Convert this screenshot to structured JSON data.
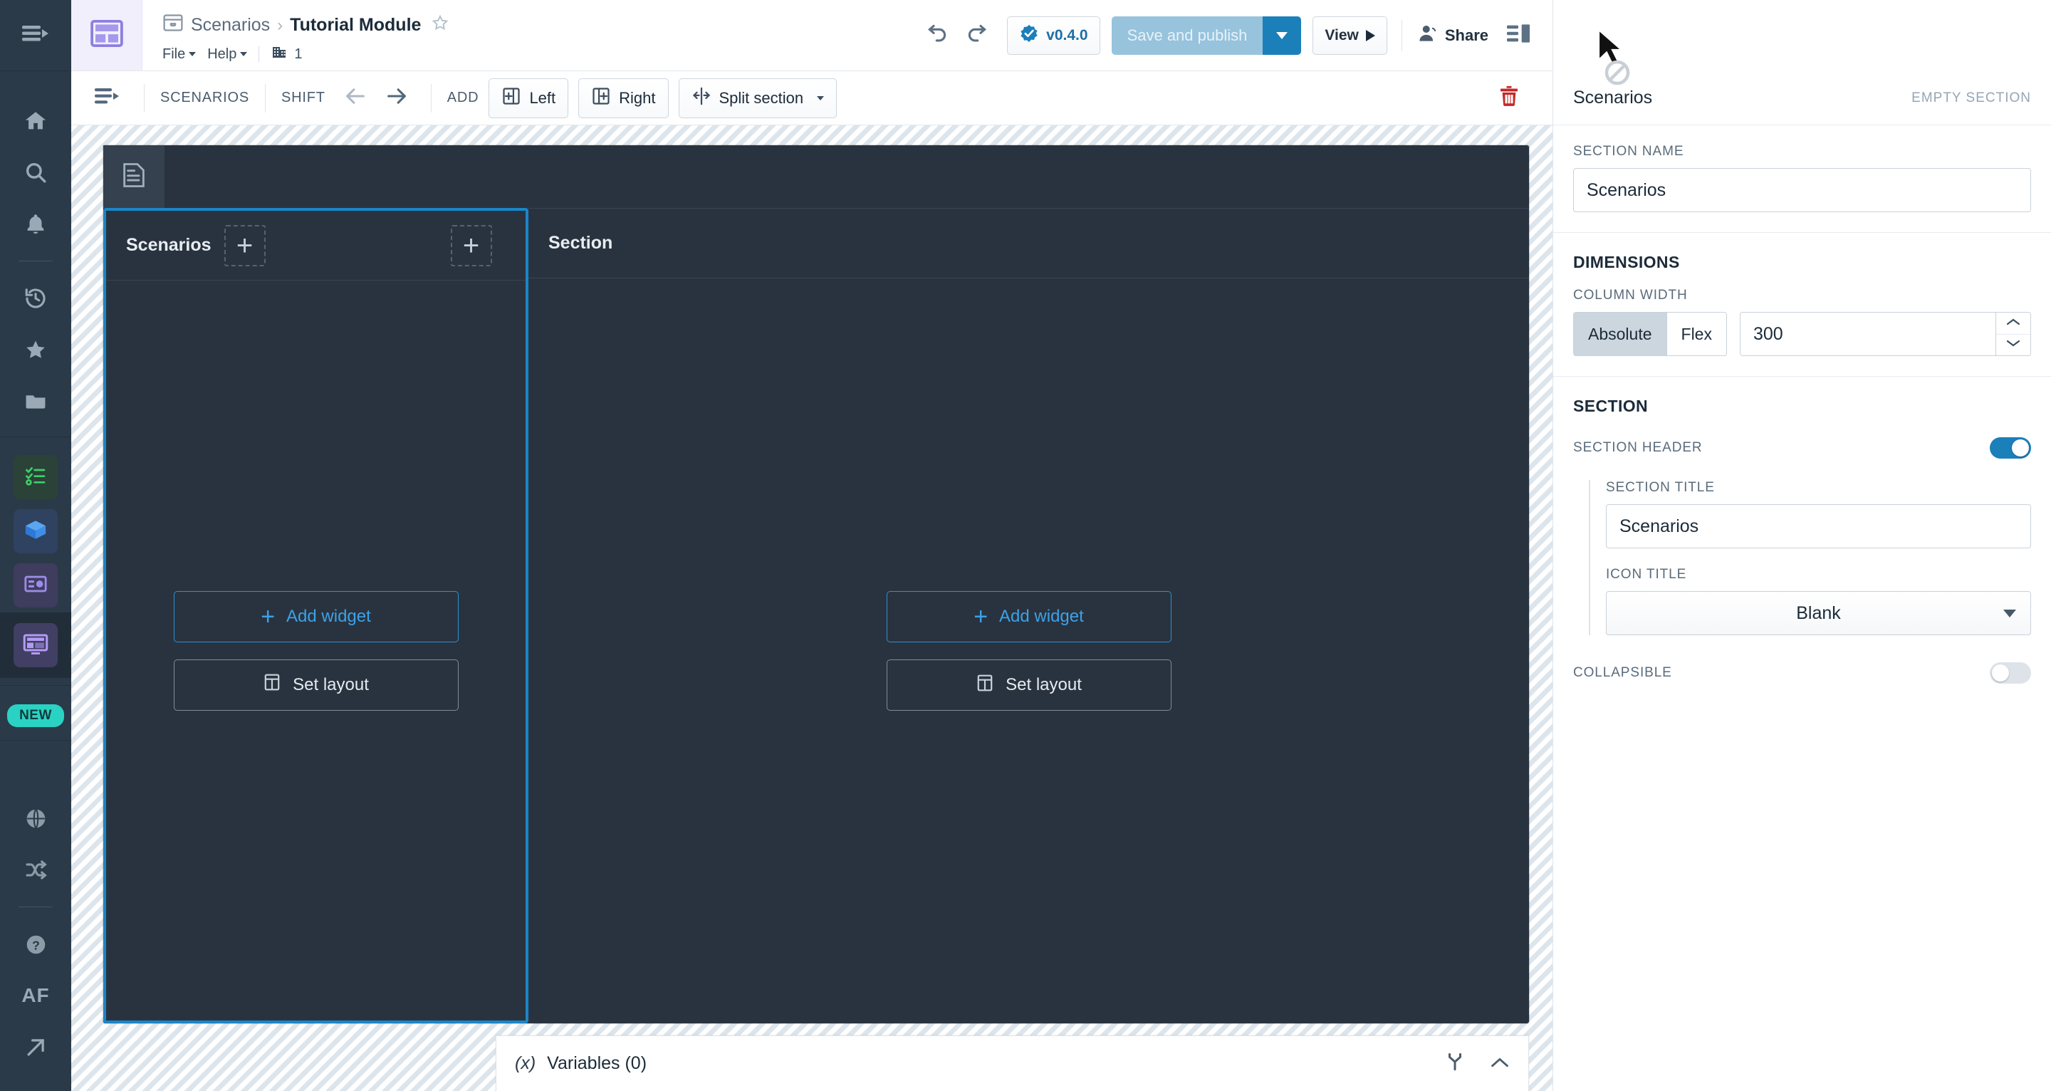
{
  "app": {
    "rail": {
      "toggle_icon": "sidebar-expand-icon",
      "items": [
        {
          "name": "home",
          "icon": "home-icon"
        },
        {
          "name": "search",
          "icon": "search-icon"
        },
        {
          "name": "notifications",
          "icon": "bell-icon"
        },
        {
          "name": "recent",
          "icon": "history-clock-icon"
        },
        {
          "name": "favorites",
          "icon": "star-icon"
        },
        {
          "name": "projects",
          "icon": "folder-icon"
        }
      ],
      "apps": [
        {
          "name": "checklist-app",
          "icon": "checklist-icon",
          "color": "#3ecf6a"
        },
        {
          "name": "object-explorer-app",
          "icon": "cube-icon",
          "color": "#3f8ee8"
        },
        {
          "name": "ontology-app",
          "icon": "ontology-icon",
          "color": "#9b8ce8"
        },
        {
          "name": "workshop-app",
          "icon": "layout-monitor-icon",
          "color": "#b39bf5",
          "active": true
        }
      ],
      "new_badge": "NEW",
      "bottom": [
        {
          "name": "globe",
          "icon": "globe-icon"
        },
        {
          "name": "shuffle",
          "icon": "shuffle-icon"
        },
        {
          "name": "help",
          "icon": "question-circle-icon"
        },
        {
          "name": "user-initials",
          "icon": "avatar-initials",
          "label": "AF"
        },
        {
          "name": "open-external",
          "icon": "arrow-up-right-icon"
        }
      ]
    },
    "header": {
      "module_icon": "module-layout-icon",
      "breadcrumb": {
        "folder_icon": "archive-icon",
        "parent": "Scenarios",
        "separator": "›",
        "title": "Tutorial Module",
        "star_icon": "star-outline-icon"
      },
      "menus": [
        {
          "label": "File"
        },
        {
          "label": "Help"
        }
      ],
      "org_icon": "building-icon",
      "org_count": "1",
      "undo_icon": "undo-icon",
      "redo_icon": "redo-icon",
      "version_label": "v0.4.0",
      "version_icon": "verified-check-icon",
      "save_label": "Save and publish",
      "save_dropdown_icon": "caret-down-icon",
      "view_label": "View",
      "view_icon": "play-icon",
      "share_label": "Share",
      "share_icon": "person-icon",
      "panel_toggle_icon": "right-panel-toggle-icon"
    },
    "toolbar": {
      "collapse_icon": "collapse-tree-icon",
      "scope_label": "SCENARIOS",
      "shift_label": "SHIFT",
      "shift_left_icon": "arrow-left-icon",
      "shift_right_icon": "arrow-right-icon",
      "add_label": "ADD",
      "add_left_label": "Left",
      "add_left_icon": "insert-left-icon",
      "add_right_label": "Right",
      "add_right_icon": "insert-right-icon",
      "split_label": "Split section",
      "split_icon": "split-section-icon",
      "split_caret_icon": "caret-down-icon",
      "delete_icon": "trash-icon"
    },
    "canvas": {
      "board_logo_icon": "document-lines-icon",
      "sections": [
        {
          "title": "Scenarios",
          "selected": true,
          "add_left_icon": "plus-icon",
          "add_right_icon": "plus-icon",
          "add_widget_label": "Add widget",
          "add_widget_icon": "plus-icon",
          "set_layout_label": "Set layout",
          "set_layout_icon": "layout-grid-icon"
        },
        {
          "title": "Section",
          "selected": false,
          "add_widget_label": "Add widget",
          "add_widget_icon": "plus-icon",
          "set_layout_label": "Set layout",
          "set_layout_icon": "layout-grid-icon"
        }
      ]
    },
    "variables_bar": {
      "fx_icon": "(x)",
      "label": "Variables (0)",
      "graph_icon": "branch-icon",
      "collapse_icon": "chevron-up-icon"
    },
    "right_panel": {
      "title": "Scenarios",
      "status_tag": "EMPTY SECTION",
      "section_name_label": "SECTION NAME",
      "section_name_value": "Scenarios",
      "dimensions_heading": "DIMENSIONS",
      "column_width_label": "COLUMN WIDTH",
      "mode_absolute": "Absolute",
      "mode_flex": "Flex",
      "mode_selected": "Absolute",
      "column_width_value": "300",
      "spinner_up_icon": "chevron-up-icon",
      "spinner_down_icon": "chevron-down-icon",
      "section_heading": "SECTION",
      "section_header_label": "SECTION HEADER",
      "section_header_on": true,
      "section_title_label": "SECTION TITLE",
      "section_title_value": "Scenarios",
      "icon_title_label": "ICON TITLE",
      "icon_title_value": "Blank",
      "icon_title_caret": "caret-down-icon",
      "collapsible_label": "COLLAPSIBLE",
      "collapsible_on": false
    },
    "colors": {
      "accent_blue": "#1b7fba",
      "selection_blue": "#1a86c8",
      "canvas_dark": "#29333f",
      "rail_dark": "#2b3a48",
      "danger_red": "#c62828",
      "new_badge": "#2ad2c4"
    }
  }
}
